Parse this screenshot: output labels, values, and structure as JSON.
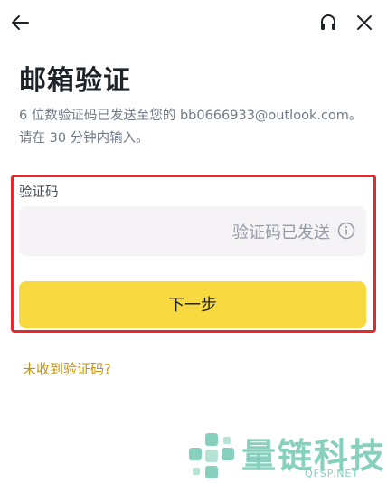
{
  "header": {
    "back_icon": "arrow-left-icon",
    "support_icon": "headset-icon",
    "close_icon": "close-icon"
  },
  "page": {
    "title": "邮箱验证",
    "subtitle_line1": "6 位数验证码已发送至您的 bb0666933@outlook.com。",
    "subtitle_line2": "请在 30 分钟内输入。"
  },
  "form": {
    "code_label": "验证码",
    "code_status": "验证码已发送",
    "info_icon": "info-circle-icon",
    "next_label": "下一步",
    "resend_link": "未收到验证码?"
  },
  "watermark": {
    "brand": "量链科技",
    "url": "QFSP.NET"
  },
  "colors": {
    "accent": "#f8d93f",
    "link": "#c99400",
    "highlight_border": "#e8282b",
    "watermark": "#86d0bd"
  }
}
